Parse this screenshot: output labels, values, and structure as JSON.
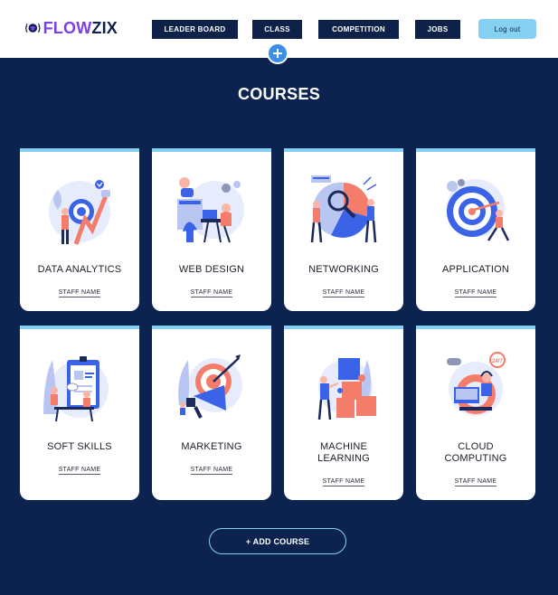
{
  "brand": {
    "part1": "FLOW",
    "part2": "ZIX"
  },
  "nav": {
    "leaderboard": "LEADER BOARD",
    "class": "CLASS",
    "competition": "COMPETITION",
    "jobs": "JOBS",
    "logout": "Log out"
  },
  "page_title": "COURSES",
  "courses": [
    {
      "title": "DATA ANALYTICS",
      "staff": "STAFF NAME",
      "icon": "data-analytics-illustration"
    },
    {
      "title": "WEB DESIGN",
      "staff": "STAFF NAME",
      "icon": "web-design-illustration"
    },
    {
      "title": "NETWORKING",
      "staff": "STAFF NAME",
      "icon": "networking-illustration"
    },
    {
      "title": "APPLICATION",
      "staff": "STAFF NAME",
      "icon": "application-illustration"
    },
    {
      "title": "SOFT SKILLS",
      "staff": "STAFF NAME",
      "icon": "soft-skills-illustration"
    },
    {
      "title": "MARKETING",
      "staff": "STAFF NAME",
      "icon": "marketing-illustration"
    },
    {
      "title": "MACHINE LEARNING",
      "staff": "STAFF NAME",
      "icon": "machine-learning-illustration"
    },
    {
      "title": "CLOUD COMPUTING",
      "staff": "STAFF NAME",
      "icon": "cloud-computing-illustration"
    }
  ],
  "add_course": "+ ADD COURSE",
  "colors": {
    "navy": "#0c2350",
    "accent": "#86d0f2",
    "brand_purple": "#7b3fe4",
    "coral": "#f47c6a",
    "blue": "#3b63e8"
  }
}
